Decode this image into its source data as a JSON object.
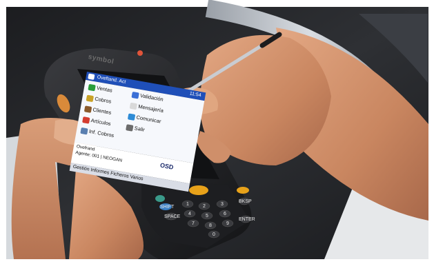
{
  "device": {
    "brand": "symbol"
  },
  "screen": {
    "title": "Oveftand. Act",
    "time": "11:54",
    "menu_items": [
      {
        "label": "Ventas",
        "color": "#2a9d3a"
      },
      {
        "label": "Validación",
        "color": "#3b6fd6"
      },
      {
        "label": "Cobros",
        "color": "#c9a227"
      },
      {
        "label": "Mensajería",
        "color": "#d9d9d9"
      },
      {
        "label": "Clientes",
        "color": "#8a5a2b"
      },
      {
        "label": "Comunicar",
        "color": "#2d8bd6"
      },
      {
        "label": "Artículos",
        "color": "#d43c2f"
      },
      {
        "label": "Inf. Cobros",
        "color": "#5a7fb0"
      },
      {
        "label": "Salir",
        "color": "#6b6b6b"
      }
    ],
    "footer_user": "Ovefrand",
    "footer_agent": "Agente: 001 | NEOGAN",
    "logo": "OSD",
    "bottom_menu": "Gestión  Informes  Ficheros  Varios"
  },
  "keypad": {
    "keys": [
      "1",
      "2",
      "3",
      "4",
      "5",
      "6",
      "7",
      "8",
      "9",
      "0",
      "SHIFT",
      "BKSP",
      "SPACE",
      "ENTER"
    ]
  },
  "colors": {
    "screen_titlebar": "#1f4fb8",
    "device_body": "#2a2b2e",
    "accent_button": "#e8a21a",
    "scan_trigger": "#d98a3a"
  }
}
